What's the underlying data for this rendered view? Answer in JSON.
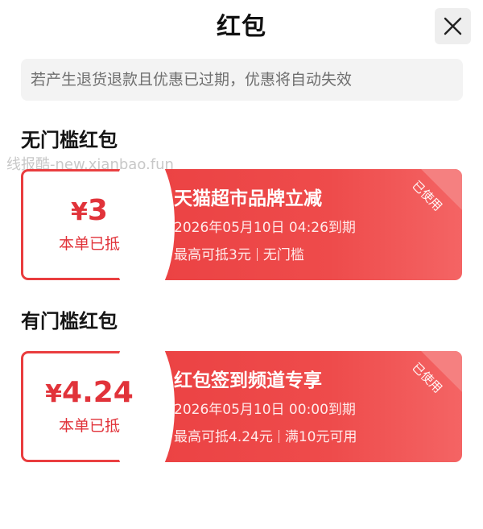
{
  "header": {
    "title": "红包",
    "close_icon": "close-icon"
  },
  "notice": "若产生退货退款且优惠已过期，优惠将自动失效",
  "watermark": "线报酷-new.xianbao.fun",
  "colors": {
    "accent_red": "#e93c3e",
    "notice_bg": "#f3f3f3"
  },
  "sections": [
    {
      "title": "无门槛红包",
      "card": {
        "currency": "¥",
        "amount": "3",
        "amount_note": "本单已抵",
        "name": "天猫超市品牌立减",
        "expiry": "2026年05月10日 04:26到期",
        "max_deduct": "最高可抵3元",
        "condition": "无门槛",
        "status_badge": "已使用"
      }
    },
    {
      "title": "有门槛红包",
      "card": {
        "currency": "¥",
        "amount": "4.24",
        "amount_note": "本单已抵",
        "name": "红包签到频道专享",
        "expiry": "2026年05月10日 00:00到期",
        "max_deduct": "最高可抵4.24元",
        "condition": "满10元可用",
        "status_badge": "已使用"
      }
    }
  ]
}
